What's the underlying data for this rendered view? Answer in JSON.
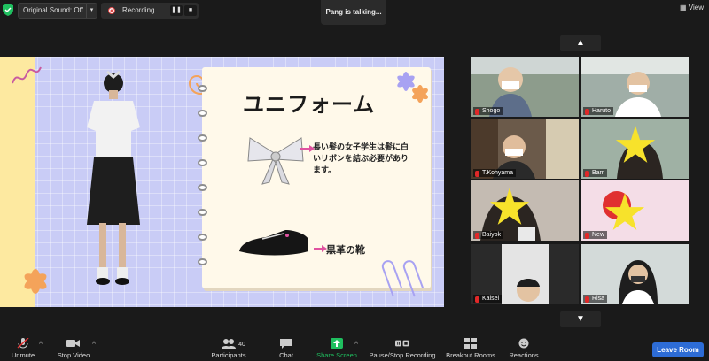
{
  "topbar": {
    "original_sound": "Original Sound: Off",
    "recording": "Recording...",
    "talking": "Pang is talking...",
    "view": "View"
  },
  "slide": {
    "title": "ユニフォーム",
    "text1": "長い髪の女子学生は髪に白いリボンを結ぶ必要があります。",
    "text2": "黒革の靴"
  },
  "gallery": {
    "participants": [
      "Shogo",
      "Haruto",
      "T.Kohyama",
      "Bam",
      "Baiyok",
      "New",
      "Kaisei",
      "Risa"
    ]
  },
  "toolbar": {
    "unmute": "Unmute",
    "stop_video": "Stop Video",
    "participants": "Participants",
    "participants_count": "40",
    "chat": "Chat",
    "share_screen": "Share Screen",
    "pause_recording": "Pause/Stop Recording",
    "breakout": "Breakout Rooms",
    "reactions": "Reactions",
    "leave": "Leave Room"
  },
  "colors": {
    "accent": "#2d6cd6",
    "share": "#1fbf5f",
    "recording": "#e04b4b"
  }
}
